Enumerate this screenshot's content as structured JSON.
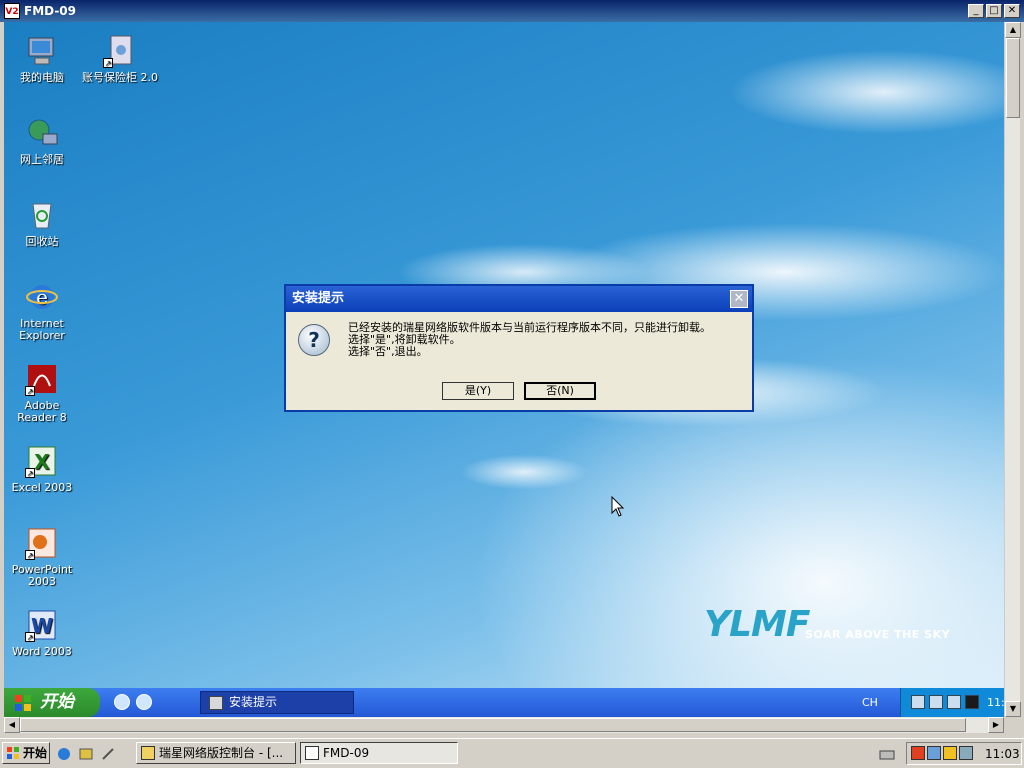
{
  "outer_window": {
    "icon_label": "V2",
    "title": "FMD-09",
    "minimize": "_",
    "maximize": "□",
    "close": "✕"
  },
  "desktop_icons": [
    {
      "label": "我的电脑",
      "icon": "my-computer-icon"
    },
    {
      "label": "账号保险柜 2.0",
      "icon": "account-safe-icon"
    },
    {
      "label": "网上邻居",
      "icon": "network-places-icon"
    },
    {
      "label": "回收站",
      "icon": "recycle-bin-icon"
    },
    {
      "label": "Internet Explorer",
      "icon": "internet-explorer-icon"
    },
    {
      "label": "Adobe Reader 8",
      "icon": "adobe-reader-icon"
    },
    {
      "label": "Excel 2003",
      "icon": "excel-icon"
    },
    {
      "label": "PowerPoint 2003",
      "icon": "powerpoint-icon"
    },
    {
      "label": "Word 2003",
      "icon": "word-icon"
    }
  ],
  "dialog": {
    "title": "安装提示",
    "close": "✕",
    "icon": "question-icon",
    "icon_glyph": "?",
    "message_line1": "已经安装的瑞星网络版软件版本与当前运行程序版本不同，只能进行卸载。",
    "message_line2": "选择\"是\",将卸载软件。",
    "message_line3": "选择\"否\",退出。",
    "yes_button": "是(Y)",
    "no_button": "否(N)"
  },
  "wallpaper": {
    "logo": "YLMF",
    "tagline": "SOAR ABOVE THE SKY"
  },
  "inner_taskbar": {
    "start_label": "开始",
    "task_item": "安装提示",
    "lang": "CH",
    "clock": "11:"
  },
  "host_taskbar": {
    "start_label": "开始",
    "tasks": [
      {
        "label": "瑞星网络版控制台 - [...",
        "active": false
      },
      {
        "label": "FMD-09",
        "active": true
      }
    ],
    "clock": "11:03"
  },
  "colors": {
    "xp_blue": "#2458d6",
    "start_green": "#3da83d",
    "dialog_bg": "#ece9d8",
    "classic_gray": "#d4d0c8"
  }
}
